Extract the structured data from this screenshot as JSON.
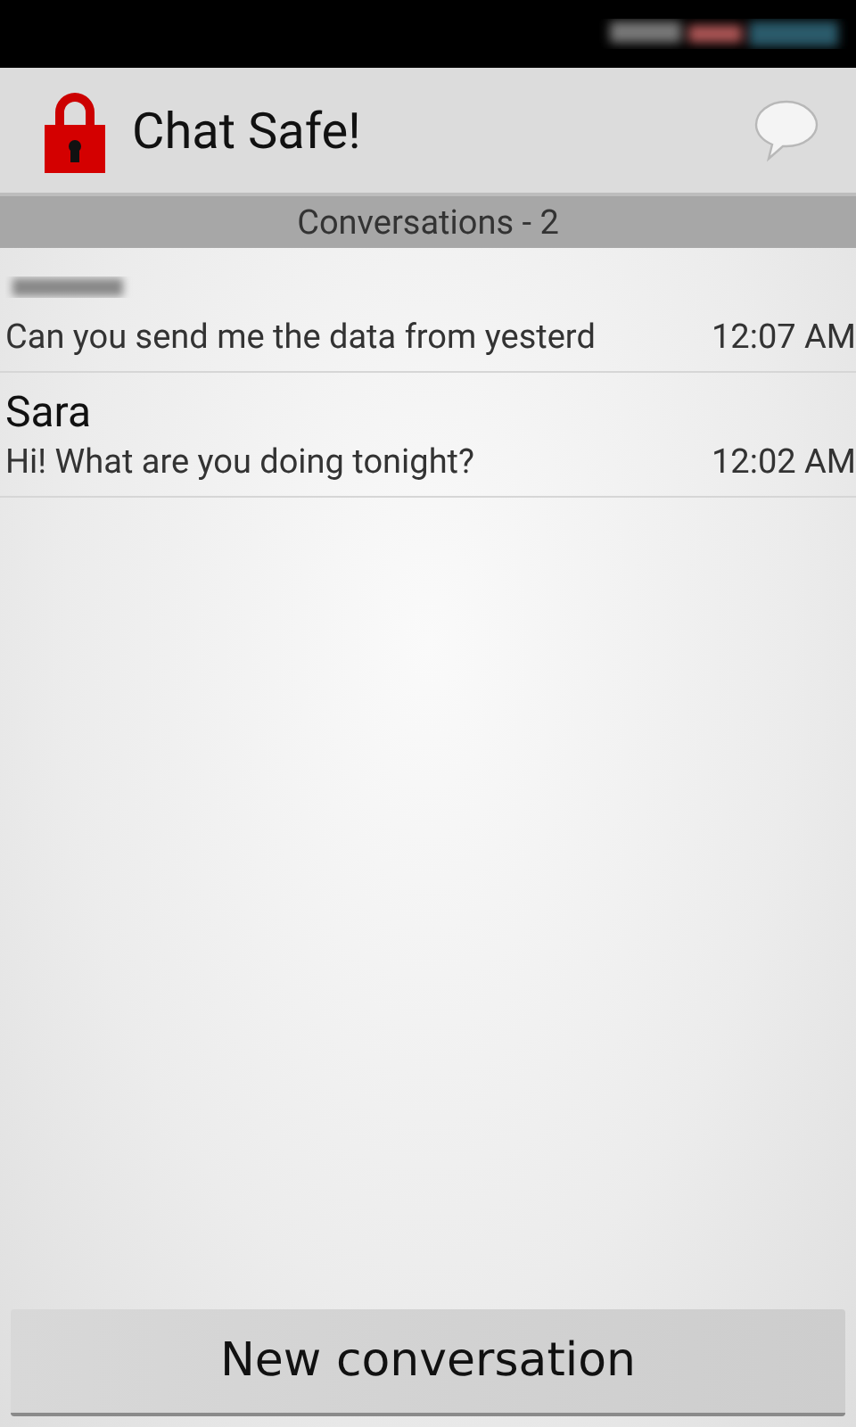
{
  "app_bar": {
    "title": "Chat Safe!"
  },
  "section_header": "Conversations - 2",
  "conversations": [
    {
      "name_redacted": true,
      "preview": "Can you send me the data from yesterd",
      "time": "12:07 AM"
    },
    {
      "name_redacted": false,
      "name": "Sara",
      "preview": "Hi! What are you doing tonight?",
      "time": "12:02 AM"
    }
  ],
  "button": "New conversation"
}
